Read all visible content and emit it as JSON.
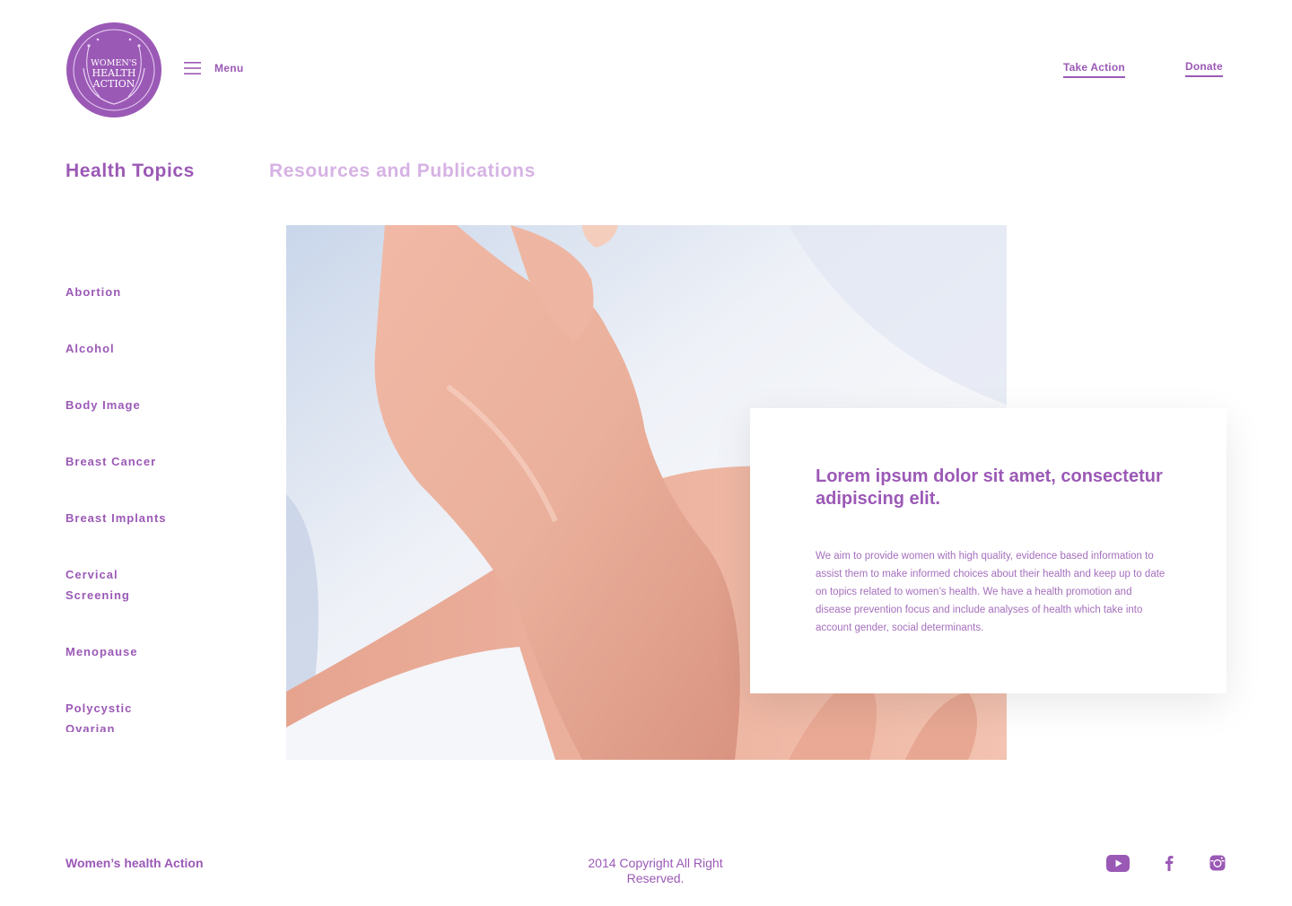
{
  "brand": {
    "logo_lines": [
      "WOMEN'S",
      "HEALTH",
      "ACTION"
    ],
    "color": "#9b59b6",
    "light_color": "#d6b2e4"
  },
  "header": {
    "menu_label": "Menu",
    "menu_icon": "hamburger-icon",
    "links": {
      "take_action": "Take Action",
      "donate": "Donate"
    }
  },
  "tabs": {
    "health_topics": "Health Topics",
    "resources": "Resources and Publications"
  },
  "topics": [
    {
      "label": "Abortion"
    },
    {
      "label": "Alcohol"
    },
    {
      "label": "Body Image"
    },
    {
      "label": "Breast Cancer"
    },
    {
      "label": "Breast Implants"
    },
    {
      "label": "Cervical Screening"
    },
    {
      "label": "Menopause"
    },
    {
      "label": "Polycystic Ovarian"
    }
  ],
  "feature": {
    "title": "Lorem ipsum dolor sit amet, consectetur adipiscing elit.",
    "body": "We aim to provide women with high quality, evidence based information to assist them to make informed choices about their health and keep up to date on topics related to women’s health.  We have a health promotion and disease prevention focus and include analyses of health which take into account gender, social determinants."
  },
  "footer": {
    "brand": "Women’s health Action",
    "copyright": "2014 Copyright All Right Reserved.",
    "social_icons": [
      "youtube-icon",
      "facebook-icon",
      "instagram-icon"
    ]
  }
}
